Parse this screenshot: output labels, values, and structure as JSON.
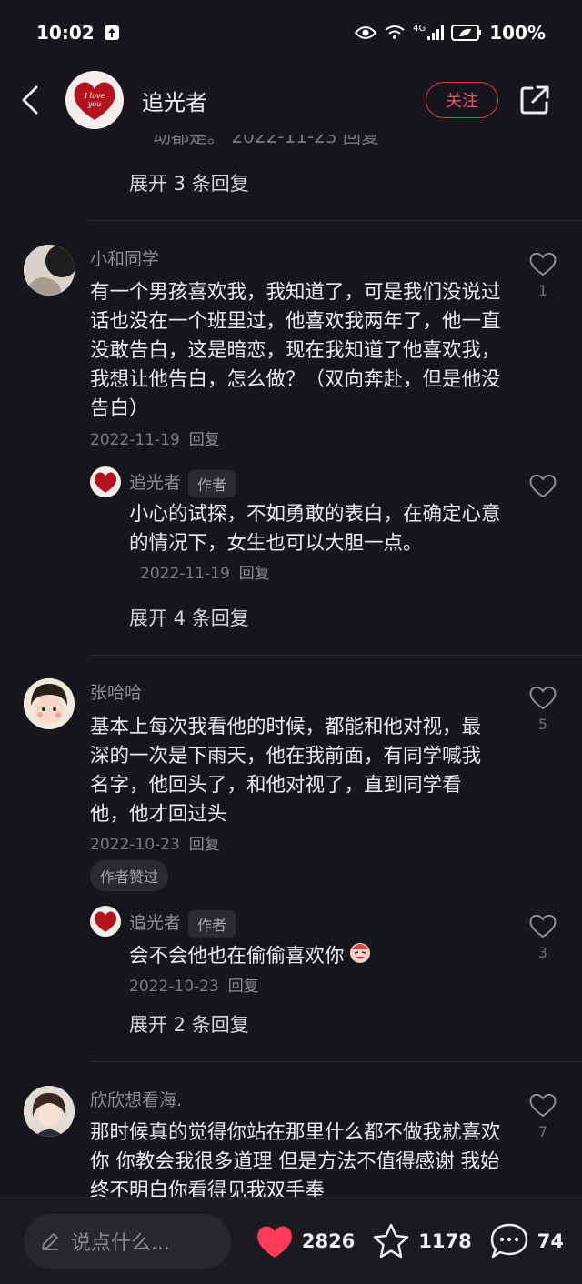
{
  "status": {
    "time": "10:02",
    "network": "4G",
    "battery": "100%"
  },
  "header": {
    "title": "追光者",
    "follow_label": "关注",
    "avatar_text": "I love you"
  },
  "top": {
    "cut_text": "动都是。  2022-11-23  回复",
    "expand_label": "展开 3 条回复"
  },
  "comments": [
    {
      "user": "小和同学",
      "text": "有一个男孩喜欢我，我知道了，可是我们没说过话也没在一个班里过，他喜欢我两年了，他一直没敢告白，这是暗恋，现在我知道了他喜欢我，我想让他告白，怎么做？（双向奔赴，但是他没告白）",
      "date": "2022-11-19",
      "reply_label": "回复",
      "likes": "1",
      "reply": {
        "user": "追光者",
        "tag": "作者",
        "text": "小心的试探，不如勇敢的表白，在确定心意的情况下，女生也可以大胆一点。",
        "date": "2022-11-19",
        "reply_label": "回复"
      },
      "expand_label": "展开 4 条回复"
    },
    {
      "user": "张哈哈",
      "text": "基本上每次我看他的时候，都能和他对视，最深的一次是下雨天，他在我前面，有同学喊我名字，他回头了，和他对视了，直到同学看他，他才回过头",
      "date": "2022-10-23",
      "reply_label": "回复",
      "likes": "5",
      "badge": "作者赞过",
      "reply": {
        "user": "追光者",
        "tag": "作者",
        "text": "会不会他也在偷偷喜欢你",
        "date": "2022-10-23",
        "reply_label": "回复",
        "likes": "3"
      },
      "expand_label": "展开 2 条回复"
    },
    {
      "user": "欣欣想看海.",
      "text": "那时候真的觉得你站在那里什么都不做我就喜欢你  你教会我很多道理 但是方法不值得感谢 我始终不明白你看得见我双手奉",
      "likes": "7"
    }
  ],
  "bottom": {
    "placeholder": "说点什么...",
    "likes": "2826",
    "favorites": "1178",
    "comments": "74"
  },
  "colors": {
    "background": "#17161c",
    "accent": "#f0506a",
    "like_heart": "#ff3b5c"
  }
}
